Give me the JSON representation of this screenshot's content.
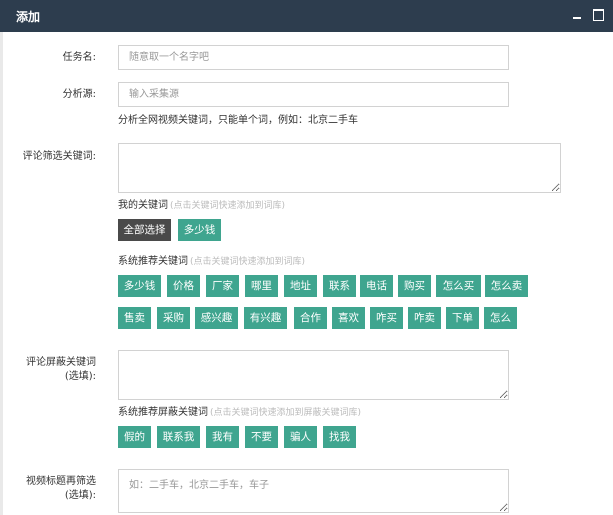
{
  "window": {
    "title": "添加"
  },
  "form": {
    "task_name": {
      "label": "任务名:",
      "placeholder": "随意取一个名字吧"
    },
    "source": {
      "label": "分析源:",
      "placeholder": "输入采集源",
      "hint": "分析全网视频关键词，只能单个词，例如：北京二手车"
    },
    "comment_filter": {
      "label": "评论筛选关键词:",
      "my_keywords_title": "我的关键词",
      "my_keywords_hint": "(点击关键词快速添加到词库)",
      "select_all": "全部选择",
      "my_keywords": [
        "多少钱"
      ],
      "sys_title": "系统推荐关键词",
      "sys_hint": "(点击关键词快速添加到词库)",
      "sys_keywords": [
        "多少钱",
        "价格",
        "厂家",
        "哪里",
        "地址",
        "联系",
        "电话",
        "购买",
        "怎么买",
        "怎么卖",
        "售卖",
        "采购",
        "感兴趣",
        "有兴趣",
        "合作",
        "喜欢",
        "咋买",
        "咋卖",
        "下单",
        "怎么"
      ]
    },
    "comment_block": {
      "label": "评论屏蔽关键词",
      "label_optional": "(选填):",
      "sys_title": "系统推荐屏蔽关键词",
      "sys_hint": "(点击关键词快速添加到屏蔽关键词库)",
      "sys_keywords": [
        "假的",
        "联系我",
        "我有",
        "不要",
        "骗人",
        "找我"
      ]
    },
    "title_filter": {
      "label": "视频标题再筛选",
      "label_optional": "(选填):",
      "placeholder": "如：二手车，北京二手车，车子"
    }
  }
}
